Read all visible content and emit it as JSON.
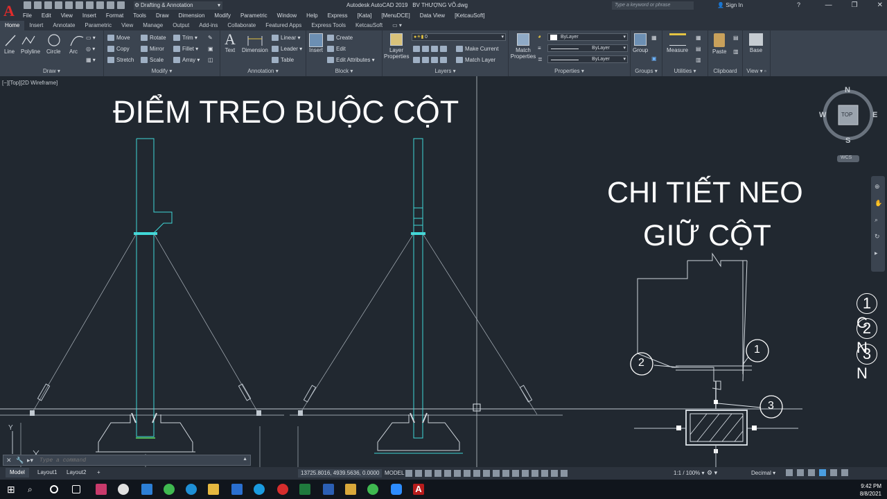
{
  "title_bar": {
    "app_title": "Autodesk AutoCAD 2019",
    "file_name": "BV THƯỢNG VÕ.dwg",
    "workspace": "Drafting & Annotation",
    "search_placeholder": "Type a keyword or phrase",
    "sign_in": "Sign In",
    "help": "?"
  },
  "menubar": [
    "File",
    "Edit",
    "View",
    "Insert",
    "Format",
    "Tools",
    "Draw",
    "Dimension",
    "Modify",
    "Parametric",
    "Window",
    "Help",
    "Express",
    "[Kata]",
    "[MenuDCE]",
    "Data View",
    "[KetcauSoft]"
  ],
  "ribbon_tabs": [
    "Home",
    "Insert",
    "Annotate",
    "Parametric",
    "View",
    "Manage",
    "Output",
    "Add-ins",
    "Collaborate",
    "Featured Apps",
    "Express Tools",
    "KetcauSoft"
  ],
  "active_tab": "Home",
  "ribbon": {
    "draw": {
      "label": "Draw",
      "tools": [
        "Line",
        "Polyline",
        "Circle",
        "Arc"
      ]
    },
    "modify": {
      "label": "Modify",
      "tools": [
        "Move",
        "Rotate",
        "Trim",
        "Copy",
        "Mirror",
        "Fillet",
        "Stretch",
        "Scale",
        "Array"
      ]
    },
    "annotation": {
      "label": "Annotation",
      "tools": [
        "Text",
        "Dimension",
        "Linear",
        "Leader",
        "Table"
      ]
    },
    "block": {
      "label": "Block",
      "tools": [
        "Insert",
        "Create",
        "Edit",
        "Edit Attributes"
      ]
    },
    "layers": {
      "label": "Layers",
      "tools": [
        "Layer Properties",
        "Make Current",
        "Match Layer"
      ],
      "current_layer": "0"
    },
    "properties": {
      "label": "Properties",
      "tools": [
        "Match Properties"
      ],
      "color": "ByLayer",
      "linetype": "ByLayer",
      "lineweight": "ByLayer"
    },
    "groups": {
      "label": "Groups",
      "tools": [
        "Group"
      ]
    },
    "utilities": {
      "label": "Utilities",
      "tools": [
        "Measure"
      ]
    },
    "clipboard": {
      "label": "Clipboard",
      "tools": [
        "Paste"
      ]
    },
    "view": {
      "label": "View",
      "tools": [
        "Base"
      ]
    }
  },
  "viewport": {
    "label": "[−][Top][2D Wireframe]",
    "heading_left": "ĐIỂM TREO BUỘC CỘT",
    "heading_right_line1": "CHI TIẾT NEO",
    "heading_right_line2": "GIỮ CỘT",
    "callouts": [
      "1",
      "2",
      "3"
    ],
    "legend_items": [
      {
        "num": "1",
        "text": "C"
      },
      {
        "num": "2",
        "text": "N"
      },
      {
        "num": "3",
        "text": "N"
      }
    ],
    "navcube": {
      "top": "TOP",
      "north": "N",
      "south": "S",
      "east": "E",
      "west": "W",
      "ucs": "WCS"
    },
    "ucs_axis": "Y"
  },
  "command_line": {
    "placeholder": "Type a command"
  },
  "status_bar": {
    "layout_tabs": [
      "Model",
      "Layout1",
      "Layout2"
    ],
    "active_layout": "Model",
    "add_layout": "+",
    "coordinates": "13725.8016, 4939.5636, 0.0000",
    "space": "MODEL",
    "scale": "1:1 / 100%",
    "units": "Decimal"
  },
  "taskbar": {
    "time": "9:42 PM",
    "date": "8/8/2021"
  },
  "colors": {
    "background": "#212830",
    "column": "#40d8d8",
    "accent": "#e12b2b"
  }
}
